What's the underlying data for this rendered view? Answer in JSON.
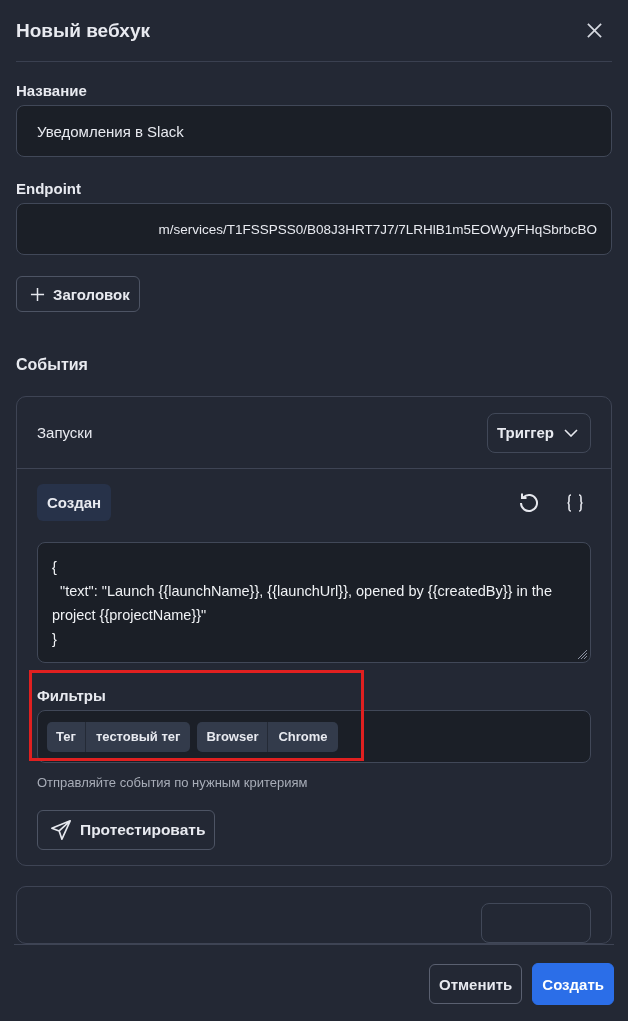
{
  "window": {
    "title": "Новый вебхук"
  },
  "fields": [
    {
      "label": "Название",
      "value": "Уведомления в Slack"
    },
    {
      "label": "Endpoint",
      "value": "m/services/T1FSSPSS0/B08J3HRT7J7/7LRHlB1m5EOWyyFHqSbrbcBO"
    }
  ],
  "add_header_button": "Заголовок",
  "events": {
    "title": "События",
    "card": {
      "title": "Запуски",
      "trigger": "Триггер",
      "event_chip": "Создан",
      "template": "{\n  \"text\": \"Launch {{launchName}}, {{launchUrl}}, opened by {{createdBy}} in the project {{projectName}}\"\n}",
      "filters": {
        "label": "Фильтры",
        "highlighted": true,
        "tags": [
          {
            "key": "Тег",
            "value": "тестовый тег"
          },
          {
            "key": "Browser",
            "value": "Chrome"
          }
        ],
        "hint": "Отправляйте события по нужным критериям"
      },
      "test_button": "Протестировать"
    }
  },
  "buttons": {
    "cancel": "Отменить",
    "create": "Создать"
  }
}
